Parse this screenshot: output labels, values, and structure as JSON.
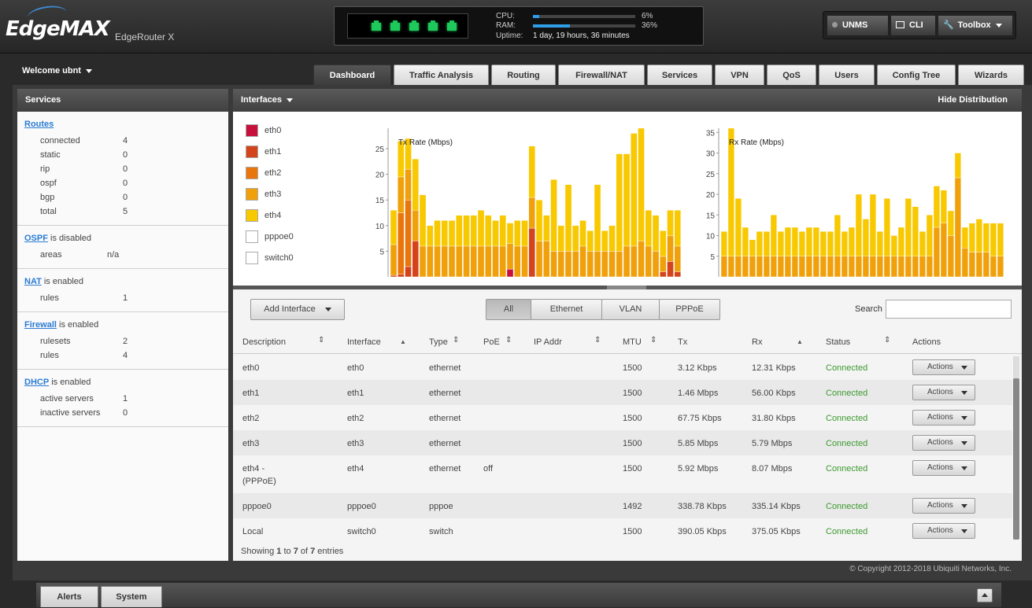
{
  "header": {
    "brand": "EdgeMAX",
    "model": "EdgeRouter X",
    "cpu_label": "CPU:",
    "cpu_value": "6%",
    "cpu_fraction": 0.06,
    "ram_label": "RAM:",
    "ram_value": "36%",
    "ram_fraction": 0.36,
    "uptime_label": "Uptime:",
    "uptime_value": "1 day, 19 hours, 36 minutes",
    "unms_label": "UNMS",
    "cli_label": "CLI",
    "toolbox_label": "Toolbox"
  },
  "welcome": "Welcome ubnt",
  "tabs": [
    "Dashboard",
    "Traffic Analysis",
    "Routing",
    "Firewall/NAT",
    "Services",
    "VPN",
    "QoS",
    "Users",
    "Config Tree",
    "Wizards"
  ],
  "services": {
    "title": "Services",
    "routes": {
      "link": "Routes",
      "rows": [
        [
          "connected",
          "4"
        ],
        [
          "static",
          "0"
        ],
        [
          "rip",
          "0"
        ],
        [
          "ospf",
          "0"
        ],
        [
          "bgp",
          "0"
        ],
        [
          "total",
          "5"
        ]
      ]
    },
    "ospf": {
      "link": "OSPF",
      "status": "is disabled",
      "rows": [
        [
          "areas",
          "n/a"
        ]
      ]
    },
    "nat": {
      "link": "NAT",
      "status": "is enabled",
      "rows": [
        [
          "rules",
          "1"
        ]
      ]
    },
    "firewall": {
      "link": "Firewall",
      "status": "is enabled",
      "rows": [
        [
          "rulesets",
          "2"
        ],
        [
          "rules",
          "4"
        ]
      ]
    },
    "dhcp": {
      "link": "DHCP",
      "status": "is enabled",
      "rows": [
        [
          "active servers",
          "1"
        ],
        [
          "inactive servers",
          "0"
        ]
      ]
    }
  },
  "interfaces_panel": {
    "title": "Interfaces",
    "hide_label": "Hide Distribution",
    "legend": [
      {
        "name": "eth0",
        "color": "#c8103c"
      },
      {
        "name": "eth1",
        "color": "#d4441c"
      },
      {
        "name": "eth2",
        "color": "#e8760c"
      },
      {
        "name": "eth3",
        "color": "#f0a00a"
      },
      {
        "name": "eth4",
        "color": "#f8c800"
      },
      {
        "name": "pppoe0",
        "color": "#ffffff"
      },
      {
        "name": "switch0",
        "color": "#ffffff"
      }
    ]
  },
  "chart_data": [
    {
      "type": "bar",
      "stacked": true,
      "title": "Tx Rate (Mbps)",
      "ylim": [
        0,
        29
      ],
      "yticks": [
        5,
        10,
        15,
        20,
        25
      ],
      "series_colors": [
        "#c8103c",
        "#d4441c",
        "#e8760c",
        "#f0a00a",
        "#f8c800"
      ],
      "stacks": [
        [
          0,
          0.3,
          0,
          6,
          6.7
        ],
        [
          0,
          0.5,
          12,
          7,
          7
        ],
        [
          0,
          2,
          13,
          6,
          6
        ],
        [
          0,
          7,
          0,
          6,
          10
        ],
        [
          0,
          0,
          0,
          6,
          10
        ],
        [
          0,
          0,
          0,
          6,
          4
        ],
        [
          0,
          0,
          0,
          6,
          5
        ],
        [
          0,
          0,
          0,
          6,
          5
        ],
        [
          0,
          0,
          0,
          6,
          5
        ],
        [
          0,
          0,
          0,
          6,
          6
        ],
        [
          0,
          0,
          0,
          6,
          6
        ],
        [
          0,
          0,
          0,
          6,
          6
        ],
        [
          0,
          0,
          0,
          6,
          7
        ],
        [
          0,
          0,
          0,
          6,
          6
        ],
        [
          0,
          0,
          0,
          6,
          5
        ],
        [
          0,
          0,
          0,
          6,
          6
        ],
        [
          1.5,
          0,
          0,
          5,
          4
        ],
        [
          0,
          0,
          0,
          6,
          5
        ],
        [
          0,
          0,
          0,
          6,
          5
        ],
        [
          0,
          9.5,
          0,
          6,
          10
        ],
        [
          0,
          0,
          0,
          7,
          8
        ],
        [
          0,
          0,
          0,
          7,
          5
        ],
        [
          0,
          0,
          0,
          5,
          14
        ],
        [
          0,
          0,
          0,
          5,
          5
        ],
        [
          0,
          0,
          0,
          5,
          13
        ],
        [
          0,
          0,
          0,
          5,
          5
        ],
        [
          0,
          0,
          0,
          6,
          5
        ],
        [
          0,
          0,
          0,
          5,
          4
        ],
        [
          0,
          0,
          0,
          5,
          13
        ],
        [
          0,
          0,
          0,
          5,
          4
        ],
        [
          0,
          0,
          0,
          5,
          5
        ],
        [
          0,
          0,
          0,
          5,
          19
        ],
        [
          0,
          0,
          0,
          6,
          18
        ],
        [
          0,
          0,
          0,
          6,
          22
        ],
        [
          0,
          0,
          0,
          7,
          22
        ],
        [
          0,
          0,
          0,
          6,
          7
        ],
        [
          0,
          0,
          0,
          5,
          7
        ],
        [
          0,
          1,
          0,
          3,
          5
        ],
        [
          0,
          3,
          0,
          5,
          5
        ],
        [
          0,
          1,
          0,
          5,
          7
        ]
      ]
    },
    {
      "type": "bar",
      "stacked": true,
      "title": "Rx Rate (Mbps)",
      "ylim": [
        0,
        36
      ],
      "yticks": [
        5,
        10,
        15,
        20,
        25,
        30,
        35
      ],
      "series_colors": [
        "#c8103c",
        "#d4441c",
        "#e8760c",
        "#f0a00a",
        "#f8c800"
      ],
      "stacks": [
        [
          0,
          0,
          0,
          5,
          6
        ],
        [
          0,
          0,
          0,
          5,
          31
        ],
        [
          0,
          0,
          0,
          5,
          14
        ],
        [
          0,
          0,
          0,
          5,
          7
        ],
        [
          0,
          0,
          0,
          5,
          4
        ],
        [
          0,
          0,
          0,
          5,
          6
        ],
        [
          0,
          0,
          0,
          5,
          6
        ],
        [
          0,
          0,
          0,
          5,
          10
        ],
        [
          0,
          0,
          0,
          5,
          6
        ],
        [
          0,
          0,
          0,
          5,
          7
        ],
        [
          0,
          0,
          0,
          5,
          7
        ],
        [
          0,
          0,
          0,
          5,
          6
        ],
        [
          0,
          0,
          0,
          5,
          7
        ],
        [
          0,
          0,
          0,
          5,
          7
        ],
        [
          0,
          0,
          0,
          5,
          6
        ],
        [
          0,
          0,
          0,
          5,
          6
        ],
        [
          0,
          0,
          0,
          5,
          10
        ],
        [
          0,
          0,
          0,
          5,
          6
        ],
        [
          0,
          0,
          0,
          5,
          7
        ],
        [
          0,
          0,
          0,
          5,
          15
        ],
        [
          0,
          0,
          0,
          5,
          9
        ],
        [
          0,
          0,
          0,
          5,
          15
        ],
        [
          0,
          0,
          0,
          5,
          6
        ],
        [
          0,
          0,
          0,
          5,
          14
        ],
        [
          0,
          0,
          0,
          5,
          5
        ],
        [
          0,
          0,
          0,
          5,
          7
        ],
        [
          0,
          0,
          0,
          5,
          14
        ],
        [
          0,
          0,
          0,
          5,
          12
        ],
        [
          0,
          0,
          0,
          5,
          6
        ],
        [
          0,
          0,
          0,
          5,
          10
        ],
        [
          0,
          0,
          0,
          12,
          10
        ],
        [
          0,
          0,
          0,
          13,
          8
        ],
        [
          0,
          0,
          0,
          10,
          6
        ],
        [
          0,
          0,
          0,
          24,
          6
        ],
        [
          0,
          0,
          0,
          7,
          5
        ],
        [
          0,
          0,
          0,
          6,
          7
        ],
        [
          0,
          0,
          0,
          6,
          8
        ],
        [
          0,
          0,
          0,
          6,
          7
        ],
        [
          0,
          0,
          0,
          5,
          8
        ],
        [
          0,
          0,
          0,
          5,
          8
        ]
      ]
    }
  ],
  "table": {
    "add_label": "Add Interface",
    "filters": [
      "All",
      "Ethernet",
      "VLAN",
      "PPPoE"
    ],
    "search_label": "Search",
    "columns": [
      "Description",
      "Interface",
      "Type",
      "PoE",
      "IP Addr",
      "MTU",
      "Tx",
      "Rx",
      "Status",
      "Actions"
    ],
    "rows": [
      {
        "desc": "eth0",
        "desc2": "",
        "iface": "eth0",
        "type": "ethernet",
        "poe": "",
        "ip": "",
        "mtu": "1500",
        "tx": "3.12 Kbps",
        "rx": "12.31 Kbps",
        "status": "Connected",
        "action": "Actions"
      },
      {
        "desc": "eth1",
        "desc2": "",
        "iface": "eth1",
        "type": "ethernet",
        "poe": "",
        "ip": "",
        "mtu": "1500",
        "tx": "1.46 Mbps",
        "rx": "56.00 Kbps",
        "status": "Connected",
        "action": "Actions"
      },
      {
        "desc": "eth2",
        "desc2": "",
        "iface": "eth2",
        "type": "ethernet",
        "poe": "",
        "ip": "",
        "mtu": "1500",
        "tx": "67.75 Kbps",
        "rx": "31.80 Kbps",
        "status": "Connected",
        "action": "Actions"
      },
      {
        "desc": "eth3",
        "desc2": "",
        "iface": "eth3",
        "type": "ethernet",
        "poe": "",
        "ip": "",
        "mtu": "1500",
        "tx": "5.85 Mbps",
        "rx": "5.79 Mbps",
        "status": "Connected",
        "action": "Actions"
      },
      {
        "desc": "eth4 -",
        "desc2": "(PPPoE)",
        "iface": "eth4",
        "type": "ethernet",
        "poe": "off",
        "ip": "",
        "mtu": "1500",
        "tx": "5.92 Mbps",
        "rx": "8.07 Mbps",
        "status": "Connected",
        "action": "Actions"
      },
      {
        "desc": "pppoe0",
        "desc2": "",
        "iface": "pppoe0",
        "type": "pppoe",
        "poe": "",
        "ip": "",
        "mtu": "1492",
        "tx": "338.78 Kbps",
        "rx": "335.14 Kbps",
        "status": "Connected",
        "action": "Actions"
      },
      {
        "desc": "Local",
        "desc2": "",
        "iface": "switch0",
        "type": "switch",
        "poe": "",
        "ip": "",
        "mtu": "1500",
        "tx": "390.05 Kbps",
        "rx": "375.05 Kbps",
        "status": "Connected",
        "action": "Actions"
      }
    ],
    "showing_prefix": "Showing ",
    "showing_from": "1",
    "showing_to_word": " to ",
    "showing_to": "7",
    "showing_of_word": " of ",
    "showing_total": "7",
    "showing_suffix": " entries"
  },
  "copyright": "© Copyright 2012-2018 Ubiquiti Networks, Inc.",
  "bottom": {
    "alerts_label": "Alerts",
    "system_label": "System"
  }
}
